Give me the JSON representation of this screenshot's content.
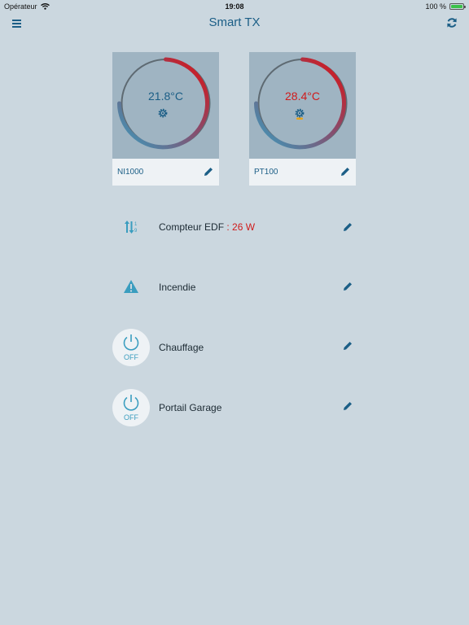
{
  "status_bar": {
    "carrier": "Opérateur",
    "time": "19:08",
    "battery": "100 %",
    "battery_level": 1.0
  },
  "nav": {
    "title": "Smart TX",
    "menu_icon": "hamburger-menu-icon",
    "refresh_icon": "refresh-icon"
  },
  "sensors": [
    {
      "label": "NI1000",
      "value": "21.8°C",
      "value_color": "#1b5e86",
      "gear_color": "#1b5e86",
      "gear_badge": false
    },
    {
      "label": "PT100",
      "value": "28.4°C",
      "value_color": "#d01b1b",
      "gear_color": "#1b5e86",
      "gear_badge": true
    }
  ],
  "rows": [
    {
      "icon": "sort-arrows-icon",
      "label": "Compteur EDF",
      "value": ": 26 W"
    },
    {
      "icon": "warning-icon",
      "label": "Incendie"
    },
    {
      "icon": "power-icon",
      "label": "Chauffage",
      "state": "OFF"
    },
    {
      "icon": "power-icon",
      "label": "Portail Garage",
      "state": "OFF"
    }
  ],
  "colors": {
    "accent": "#1b5e86",
    "teal": "#3a9dbf",
    "alert": "#d01b1b",
    "background": "#cbd7df"
  }
}
